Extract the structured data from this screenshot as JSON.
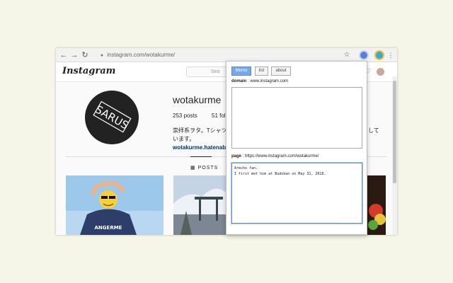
{
  "browser": {
    "url": "instagram.com/wotakurme/"
  },
  "instagram": {
    "logo": "Instagram",
    "search_placeholder": "Sea",
    "username": "wotakurme",
    "stats": {
      "posts": "253 posts",
      "followers_partial": "51 foll"
    },
    "bio_line1": "崇拝系ヲタ。Tシャツ",
    "bio_line1_tail": "して",
    "bio_line2": "います。",
    "bio_link": "wotakurme.hatenabl",
    "profile_pic_text": "SARUS",
    "posts_tab": "POSTS",
    "shirt_text": "ANGERME"
  },
  "popup": {
    "tabs": [
      {
        "label": "Memo",
        "active": true
      },
      {
        "label": "list",
        "active": false
      },
      {
        "label": "about",
        "active": false
      }
    ],
    "domain_label": "domain",
    "domain_value": ": www.instagram.com",
    "domain_memo": "",
    "page_label": "page",
    "page_value": ": https://www.instagram.com/wotakurme/",
    "page_memo": "Arecho fan.\nI first met him at Budokan on May 31, 2018."
  },
  "colors": {
    "accent_tab": "#7aa6ee",
    "background": "#f6f6e8"
  }
}
